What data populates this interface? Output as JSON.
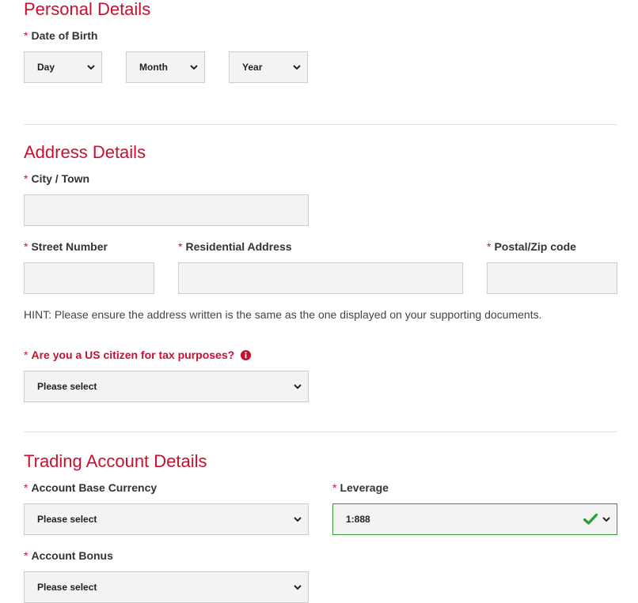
{
  "personal": {
    "title": "Personal Details",
    "dob_label": "Date of Birth",
    "day": "Day",
    "month": "Month",
    "year": "Year"
  },
  "address": {
    "title": "Address Details",
    "city_label": "City / Town",
    "city_value": "",
    "street_number_label": "Street Number",
    "street_number_value": "",
    "residential_label": "Residential Address",
    "residential_value": "",
    "postal_label": "Postal/Zip code",
    "postal_value": "",
    "hint": "HINT: Please ensure the address written is the same as the one displayed on your supporting documents.",
    "us_citizen_label": "Are you a US citizen for tax purposes?",
    "us_citizen_value": "Please select"
  },
  "trading": {
    "title": "Trading Account Details",
    "currency_label": "Account Base Currency",
    "currency_value": "Please select",
    "leverage_label": "Leverage",
    "leverage_value": "1:888",
    "bonus_label": "Account Bonus",
    "bonus_value": "Please select"
  },
  "required_marker": "*",
  "colors": {
    "accent": "#c8102e",
    "field_bg": "#f3f3f3",
    "field_border": "#cccccc",
    "valid_border": "#3a9a3a",
    "check": "#2e9e3a"
  },
  "icons": {
    "chevron": "chevron-down-icon",
    "info": "info-icon",
    "check": "checkmark-icon"
  }
}
